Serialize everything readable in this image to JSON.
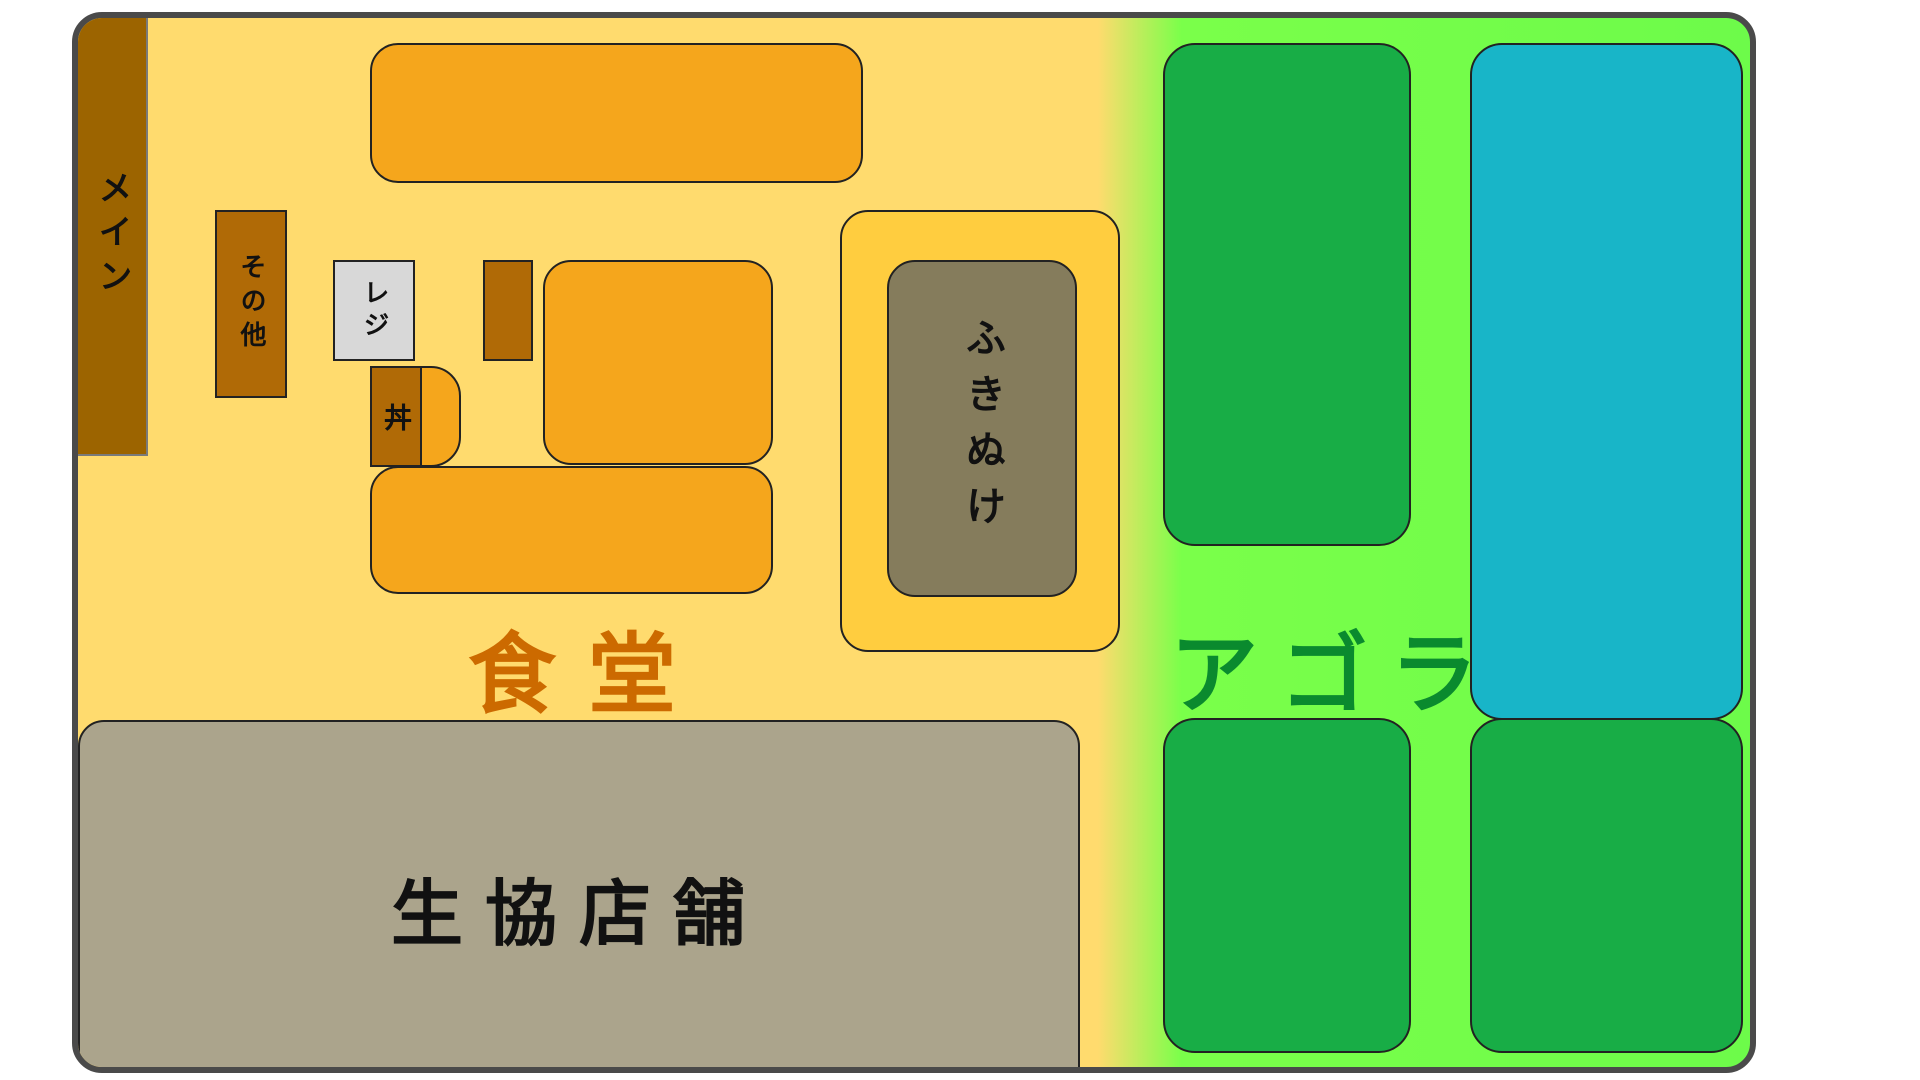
{
  "labels": {
    "main": "メイン",
    "other": "その他",
    "register": "レジ",
    "don": "丼",
    "fukinuke": "ふきぬけ",
    "cafeteria": "食堂",
    "agora": "アゴラ",
    "coop_store": "生協店舗"
  },
  "colors": {
    "cafeteria_floor": "#ffdb6e",
    "agora_floor": "#6dfb4a",
    "food_tray": "#f5a61c",
    "counter": "#b06a06",
    "main_strip": "#9c6400",
    "register": "#d8d8d8",
    "atrium_outer": "#ffcd3f",
    "atrium_inner": "#857c5c",
    "agora_area": "#18ad46",
    "water_area": "#18b5c8",
    "store": "#aba48c",
    "cafeteria_label": "#cc6a00",
    "agora_label": "#0a8a2e"
  }
}
